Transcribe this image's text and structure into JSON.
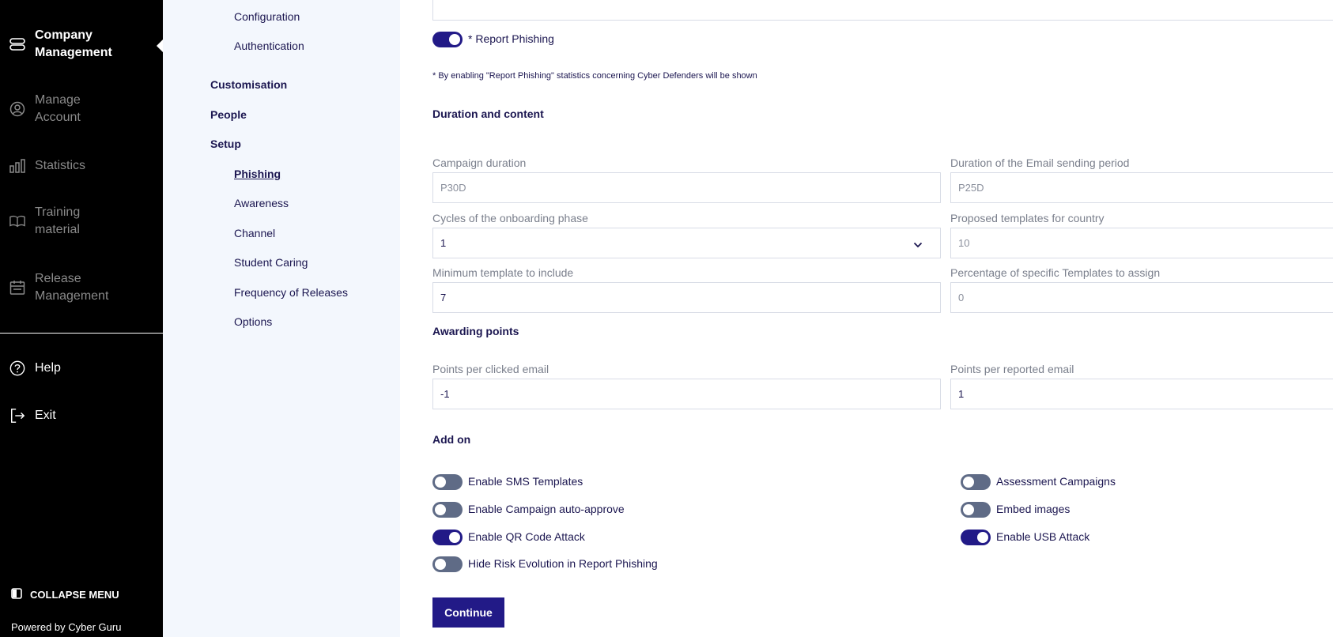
{
  "nav": {
    "items": [
      {
        "label": "Company Management",
        "icon": "layers-icon"
      },
      {
        "label": "Manage Account",
        "icon": "user-circle-icon"
      },
      {
        "label": "Statistics",
        "icon": "bar-chart-icon"
      },
      {
        "label": "Training material",
        "icon": "book-icon"
      },
      {
        "label": "Release Management",
        "icon": "calendar-icon"
      },
      {
        "label": "Help",
        "icon": "help-icon"
      },
      {
        "label": "Exit",
        "icon": "exit-icon"
      }
    ],
    "collapse_label": "COLLAPSE MENU",
    "powered_by": "Powered by Cyber Guru"
  },
  "submenu": {
    "configuration": "Configuration",
    "authentication": "Authentication",
    "customisation": "Customisation",
    "people": "People",
    "setup": "Setup",
    "phishing": "Phishing",
    "awareness": "Awareness",
    "channel": "Channel",
    "student_caring": "Student Caring",
    "frequency": "Frequency of Releases",
    "options": "Options"
  },
  "report_phishing": {
    "label": "* Report Phishing",
    "on": true
  },
  "note": "* By enabling \"Report Phishing\" statistics concerning Cyber Defenders will be shown",
  "duration": {
    "title": "Duration and content",
    "campaign_duration": {
      "label": "Campaign duration",
      "value": "P30D"
    },
    "email_period": {
      "label": "Duration of the Email sending period",
      "value": "P25D"
    },
    "onboarding_cycles": {
      "label": "Cycles of the onboarding phase",
      "value": "1"
    },
    "proposed_templates": {
      "label": "Proposed templates for country",
      "value": "10"
    },
    "min_template": {
      "label": "Minimum template to include",
      "value": "7"
    },
    "pct_specific": {
      "label": "Percentage of specific Templates to assign",
      "value": "0"
    }
  },
  "points": {
    "title": "Awarding points",
    "clicked": {
      "label": "Points per clicked email",
      "value": "-1"
    },
    "reported": {
      "label": "Points per reported email",
      "value": "1"
    }
  },
  "addon": {
    "title": "Add on",
    "sms": {
      "label": "Enable SMS Templates",
      "on": false
    },
    "assessment": {
      "label": "Assessment Campaigns",
      "on": false
    },
    "auto_approve": {
      "label": "Enable Campaign auto-approve",
      "on": false
    },
    "embed_images": {
      "label": "Embed images",
      "on": false
    },
    "qr": {
      "label": "Enable QR Code Attack",
      "on": true
    },
    "usb": {
      "label": "Enable USB Attack",
      "on": true
    },
    "hide_risk": {
      "label": "Hide Risk Evolution in Report Phishing",
      "on": false
    }
  },
  "continue_label": "Continue",
  "colors": {
    "accent": "#221a87",
    "nav_bg": "#000000",
    "submenu_bg": "#f3f7fd",
    "toggle_off": "#5f6b86"
  }
}
